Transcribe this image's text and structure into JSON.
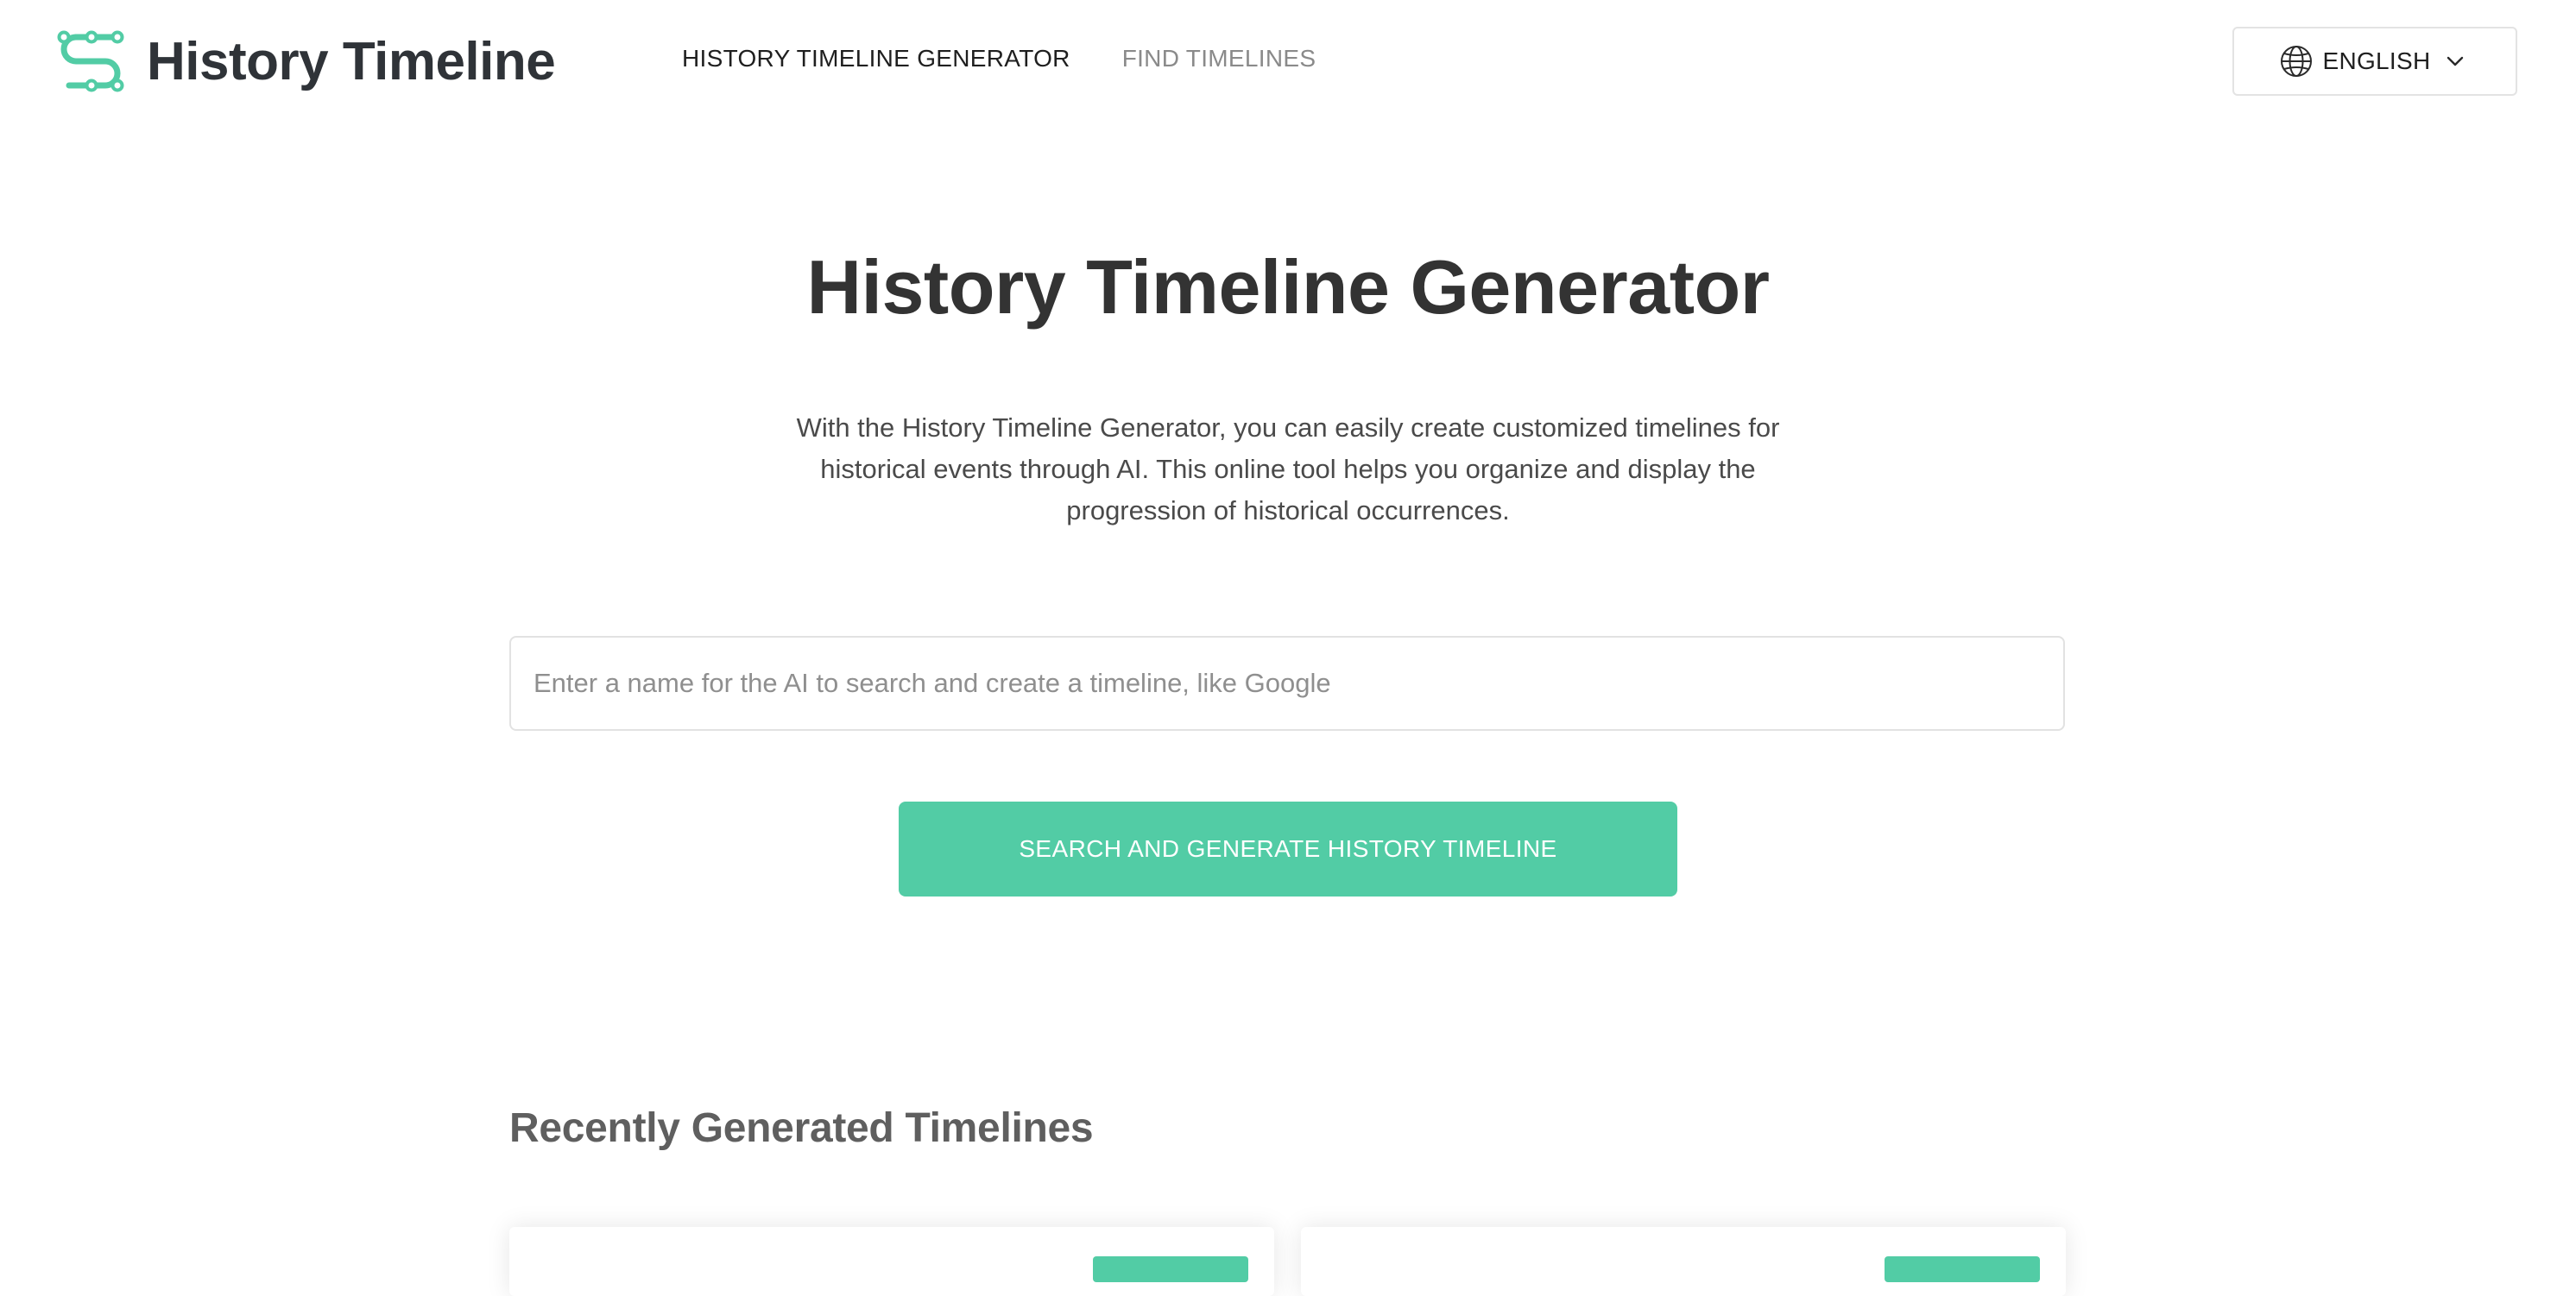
{
  "brand": {
    "name": "History Timeline",
    "logo_icon": "timeline-logo-icon",
    "accent_color": "#52cca5"
  },
  "nav": {
    "items": [
      {
        "label": "HISTORY TIMELINE GENERATOR",
        "active": true
      },
      {
        "label": "FIND TIMELINES",
        "active": false
      }
    ]
  },
  "language": {
    "selected": "ENGLISH",
    "icon": "globe-icon",
    "caret_icon": "chevron-down-icon"
  },
  "hero": {
    "title": "History Timeline Generator",
    "description": "With the History Timeline Generator, you can easily create customized timelines for historical events through AI. This online tool helps you organize and display the progression of historical occurrences."
  },
  "search": {
    "value": "",
    "placeholder": "Enter a name for the AI to search and create a timeline, like Google"
  },
  "generate_button": {
    "label": "SEARCH AND GENERATE HISTORY TIMELINE"
  },
  "recent": {
    "heading": "Recently Generated Timelines"
  }
}
